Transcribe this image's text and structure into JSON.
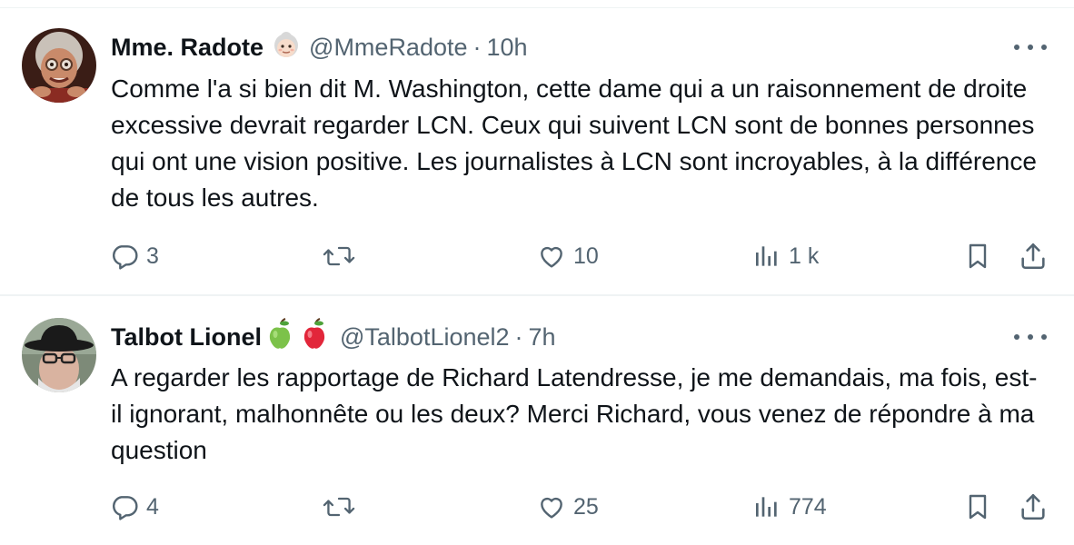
{
  "tweets": [
    {
      "name": "Mme. Radote",
      "name_emoji": "👵🏻",
      "handle": "@MmeRadote",
      "separator": "·",
      "time": "10h",
      "text": "Comme l'a si bien dit M. Washington, cette dame qui a un raisonnement de droite excessive devrait regarder LCN. Ceux qui suivent LCN sont de bonnes personnes qui ont une vision positive. Les journalistes à LCN sont incroyables, à la différence de tous les autres.",
      "replies": "3",
      "retweets": "",
      "likes": "10",
      "views": "1 k"
    },
    {
      "name": "Talbot Lionel",
      "name_emoji": "🍏 🍎",
      "handle": "@TalbotLionel2",
      "separator": "·",
      "time": "7h",
      "text": "A regarder les rapportage de Richard Latendresse, je me demandais, ma fois, est-il ignorant, malhonnête ou les deux? Merci Richard, vous venez de répondre à ma question",
      "replies": "4",
      "retweets": "",
      "likes": "25",
      "views": "774"
    }
  ],
  "icons": {
    "reply": "reply-icon",
    "retweet": "retweet-icon",
    "like": "heart-icon",
    "views": "views-icon",
    "bookmark": "bookmark-icon",
    "share": "share-icon",
    "more": "more-icon"
  },
  "colors": {
    "text": "#0f1419",
    "secondary": "#536471",
    "border": "#eff3f4"
  }
}
